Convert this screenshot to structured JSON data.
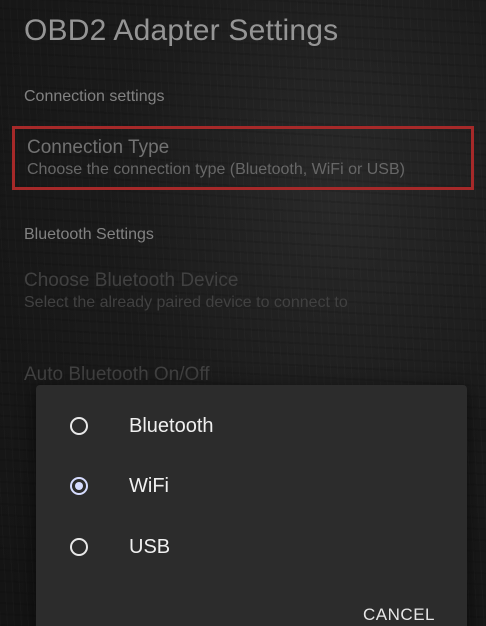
{
  "app_title": "OBD2 Adapter Settings",
  "sections": {
    "connection_header": "Connection settings",
    "bluetooth_header": "Bluetooth Settings"
  },
  "prefs": {
    "connection_type": {
      "title": "Connection Type",
      "summary": "Choose the connection type (Bluetooth, WiFi or USB)"
    },
    "choose_bt_device": {
      "title": "Choose Bluetooth Device",
      "summary": "Select the already paired device to connect to"
    },
    "auto_bt": {
      "title": "Auto Bluetooth On/Off"
    }
  },
  "dialog": {
    "options": [
      {
        "label": "Bluetooth",
        "selected": false
      },
      {
        "label": "WiFi",
        "selected": true
      },
      {
        "label": "USB",
        "selected": false
      }
    ],
    "cancel_label": "CANCEL"
  },
  "colors": {
    "highlight_border": "#e63a3a",
    "radio_checked": "#d6dcff"
  }
}
